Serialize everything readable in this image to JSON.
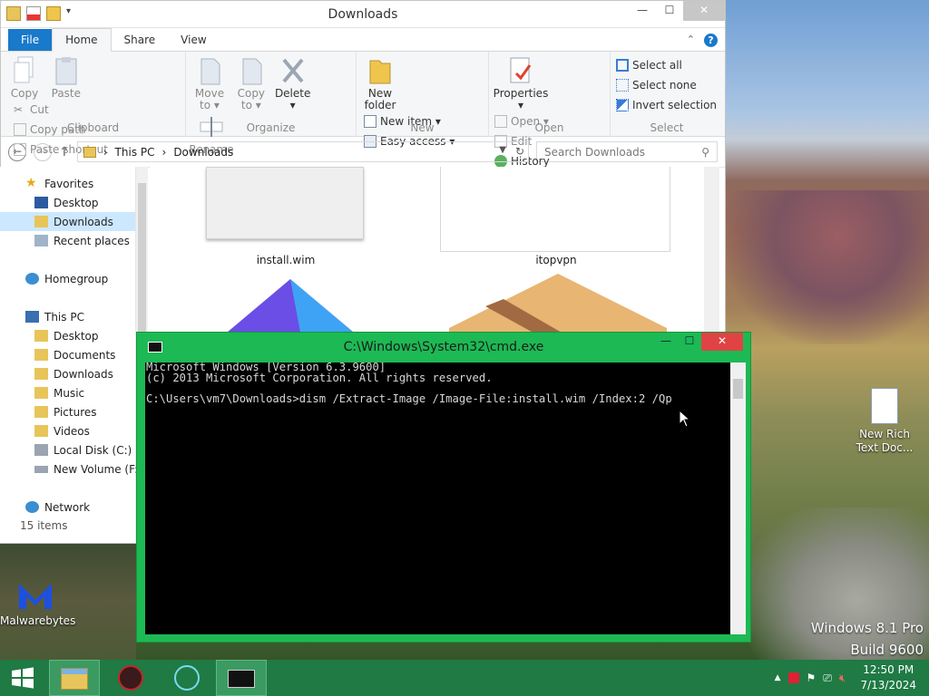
{
  "explorer": {
    "title": "Downloads",
    "tabs": [
      "File",
      "Home",
      "Share",
      "View"
    ],
    "ribbon": {
      "clipboard": {
        "label": "Clipboard",
        "copy": "Copy",
        "paste": "Paste",
        "cut": "Cut",
        "copy_path": "Copy path",
        "paste_shortcut": "Paste shortcut"
      },
      "organize": {
        "label": "Organize",
        "move_to": "Move to ▾",
        "copy_to": "Copy to ▾",
        "delete": "Delete",
        "delete_arrow": "▾",
        "rename": "Rename"
      },
      "new": {
        "label": "New",
        "new_folder_1": "New",
        "new_folder_2": "folder",
        "new_item": "New item ▾",
        "easy_access": "Easy access ▾"
      },
      "open": {
        "label": "Open",
        "properties": "Properties",
        "properties_arrow": "▾",
        "open": "Open ▾",
        "edit": "Edit",
        "history": "History"
      },
      "select": {
        "label": "Select",
        "select_all": "Select all",
        "select_none": "Select none",
        "invert_selection": "Invert selection"
      }
    },
    "address": {
      "crumbs": [
        "This PC",
        "Downloads"
      ],
      "separator": "›",
      "search_placeholder": "Search Downloads"
    },
    "nav": {
      "favorites": "Favorites",
      "favorites_items": [
        "Desktop",
        "Downloads",
        "Recent places"
      ],
      "homegroup": "Homegroup",
      "this_pc": "This PC",
      "this_pc_items": [
        "Desktop",
        "Documents",
        "Downloads",
        "Music",
        "Pictures",
        "Videos",
        "Local Disk (C:)",
        "New Volume (F:)"
      ],
      "network": "Network"
    },
    "status": "15 items",
    "files": [
      "install.wim",
      "itopvpn"
    ]
  },
  "cmd": {
    "title": "C:\\Windows\\System32\\cmd.exe",
    "lines": [
      "Microsoft Windows [Version 6.3.9600]",
      "(c) 2013 Microsoft Corporation. All rights reserved.",
      "",
      "C:\\Users\\vm7\\Downloads>dism /Extract-Image /Image-File:install.wim /Index:2 /Qp"
    ]
  },
  "desktop": {
    "icons": {
      "rtf": "New Rich Text Doc...",
      "malwarebytes": "Malwarebytes"
    },
    "watermark": {
      "line1": "Windows 8.1 Pro",
      "line2": "Build 9600"
    }
  },
  "taskbar": {
    "time": "12:50 PM",
    "date": "7/13/2024",
    "apps": [
      "start-button",
      "file-explorer",
      "antivirus",
      "vpn",
      "cmd"
    ]
  }
}
